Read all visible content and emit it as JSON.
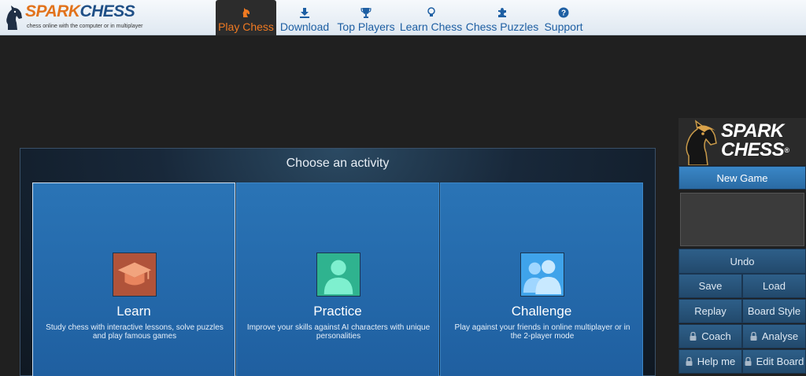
{
  "header": {
    "brand_spark": "SPARK",
    "brand_chess": "CHESS",
    "tagline": "chess online with the computer or in multiplayer",
    "nav": [
      {
        "label": "Play Chess",
        "icon": "knight-icon",
        "active": true
      },
      {
        "label": "Download",
        "icon": "download-icon"
      },
      {
        "label": "Top Players",
        "icon": "trophy-icon"
      },
      {
        "label": "Learn Chess",
        "icon": "lightbulb-icon"
      },
      {
        "label": "Chess Puzzles",
        "icon": "puzzle-icon"
      },
      {
        "label": "Support",
        "icon": "question-icon"
      }
    ]
  },
  "main": {
    "title": "Choose an activity",
    "cards": [
      {
        "title": "Learn",
        "icon": "graduation-cap-icon",
        "icon_color": "#b0533a",
        "description": "Study chess with interactive lessons, solve puzzles and play famous games"
      },
      {
        "title": "Practice",
        "icon": "user-icon",
        "icon_color": "#2fb38f",
        "description": "Improve your skills against AI characters with unique personalities"
      },
      {
        "title": "Challenge",
        "icon": "users-icon",
        "icon_color": "#3fa3ea",
        "description": "Play against your friends in online multiplayer or in the 2-player mode"
      }
    ]
  },
  "sidebar": {
    "logo_line1": "SPARK",
    "logo_line2": "CHESS",
    "logo_mark": "®",
    "new_game": "New Game",
    "undo": "Undo",
    "save": "Save",
    "load": "Load",
    "replay": "Replay",
    "board_style": "Board Style",
    "coach": "Coach",
    "analyse": "Analyse",
    "help_me": "Help me",
    "edit_board": "Edit Board"
  },
  "colors": {
    "accent_orange": "#f07a22",
    "nav_blue": "#1e5fa3",
    "card_blue": "#2a74b6"
  }
}
